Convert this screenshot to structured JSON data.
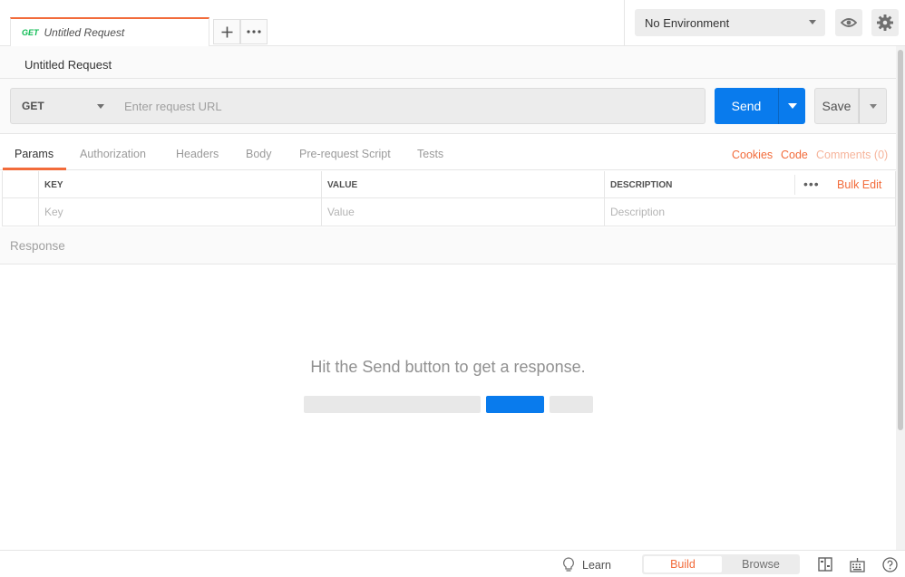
{
  "tabs": {
    "active_tab": {
      "method": "GET",
      "name": "Untitled Request"
    },
    "add_icon": "plus-icon",
    "more_icon": "more-dots-icon"
  },
  "environment": {
    "selected": "No Environment",
    "eye_icon": "eye-icon",
    "settings_icon": "gear-icon"
  },
  "request": {
    "title": "Untitled Request",
    "method": "GET",
    "url_placeholder": "Enter request URL",
    "url_value": "",
    "send_label": "Send",
    "save_label": "Save"
  },
  "subtabs": {
    "items": [
      "Params",
      "Authorization",
      "Headers",
      "Body",
      "Pre-request Script",
      "Tests"
    ],
    "active": "Params",
    "right_links": [
      "Cookies",
      "Code",
      "Comments (0)"
    ]
  },
  "params": {
    "headers": {
      "key": "KEY",
      "value": "VALUE",
      "description": "DESCRIPTION"
    },
    "placeholders": {
      "key": "Key",
      "value": "Value",
      "description": "Description"
    },
    "bulk_edit": "Bulk Edit"
  },
  "response": {
    "title": "Response",
    "hint": "Hit the Send button to get a response."
  },
  "statusbar": {
    "learn": "Learn",
    "build": "Build",
    "browse": "Browse",
    "active_mode": "Build"
  },
  "colors": {
    "accent_orange": "#f26b3a",
    "primary_blue": "#097bed",
    "get_green": "#0cbb52"
  }
}
